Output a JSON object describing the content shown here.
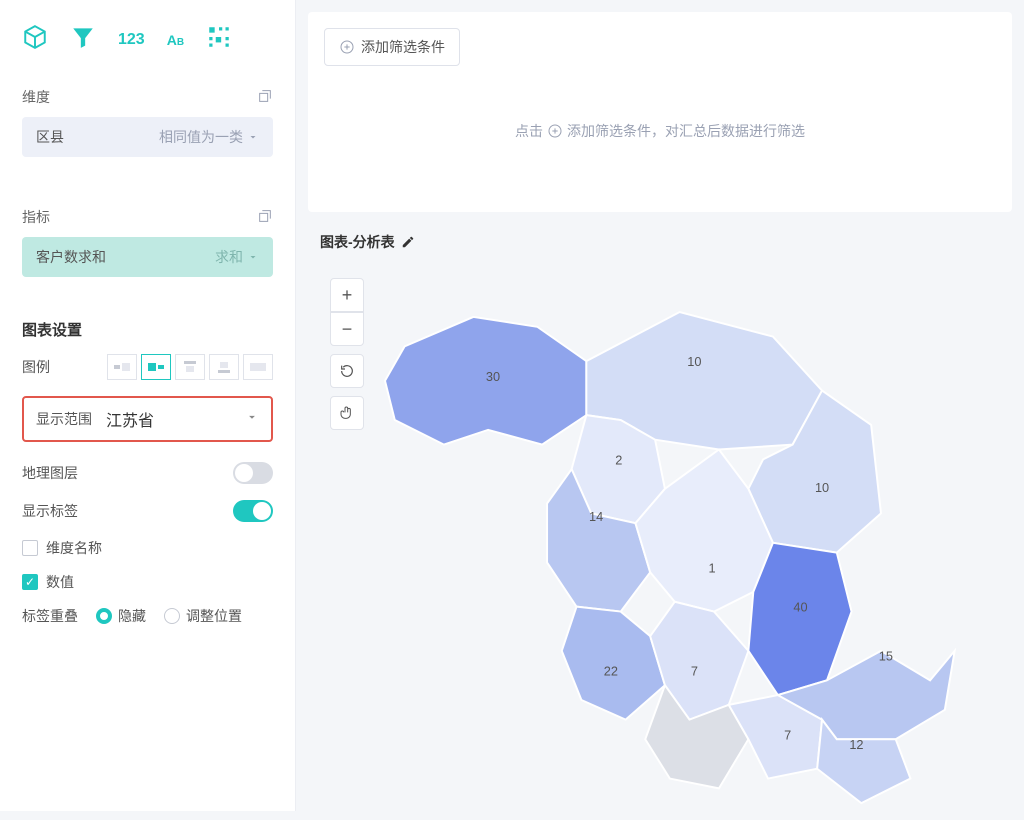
{
  "sidebar": {
    "dimension_header": "维度",
    "dimension_chip": {
      "label": "区县",
      "right": "相同值为一类"
    },
    "metric_header": "指标",
    "metric_chip": {
      "label": "客户数求和",
      "right": "求和"
    },
    "chart_settings_title": "图表设置",
    "legend_label": "图例",
    "scope_label": "显示范围",
    "scope_value": "江苏省",
    "geo_layer_label": "地理图层",
    "show_label_label": "显示标签",
    "dimension_name_label": "维度名称",
    "value_label": "数值",
    "label_overlap_label": "标签重叠",
    "label_overlap_opts": {
      "hide": "隐藏",
      "adjust": "调整位置"
    }
  },
  "filter": {
    "add_button": "添加筛选条件",
    "hint_prefix": "点击 ",
    "hint_mid": " 添加筛选条件，对汇总后数据进行筛选"
  },
  "chart": {
    "title": "图表-分析表"
  },
  "chart_data": {
    "type": "map",
    "region": "江苏省",
    "title": "图表-分析表",
    "metric": "客户数求和",
    "series": [
      {
        "name": "1",
        "value": 1
      },
      {
        "name": "2",
        "value": 2
      },
      {
        "name": "7",
        "value": 7
      },
      {
        "name": "7",
        "value": 7
      },
      {
        "name": "10",
        "value": 10
      },
      {
        "name": "10",
        "value": 10
      },
      {
        "name": "12",
        "value": 12
      },
      {
        "name": "14",
        "value": 14
      },
      {
        "name": "15",
        "value": 15
      },
      {
        "name": "22",
        "value": 22
      },
      {
        "name": "30",
        "value": 30
      },
      {
        "name": "40",
        "value": 40
      }
    ],
    "color_scale": {
      "low": "#e9eefb",
      "high": "#6b85ea"
    }
  }
}
